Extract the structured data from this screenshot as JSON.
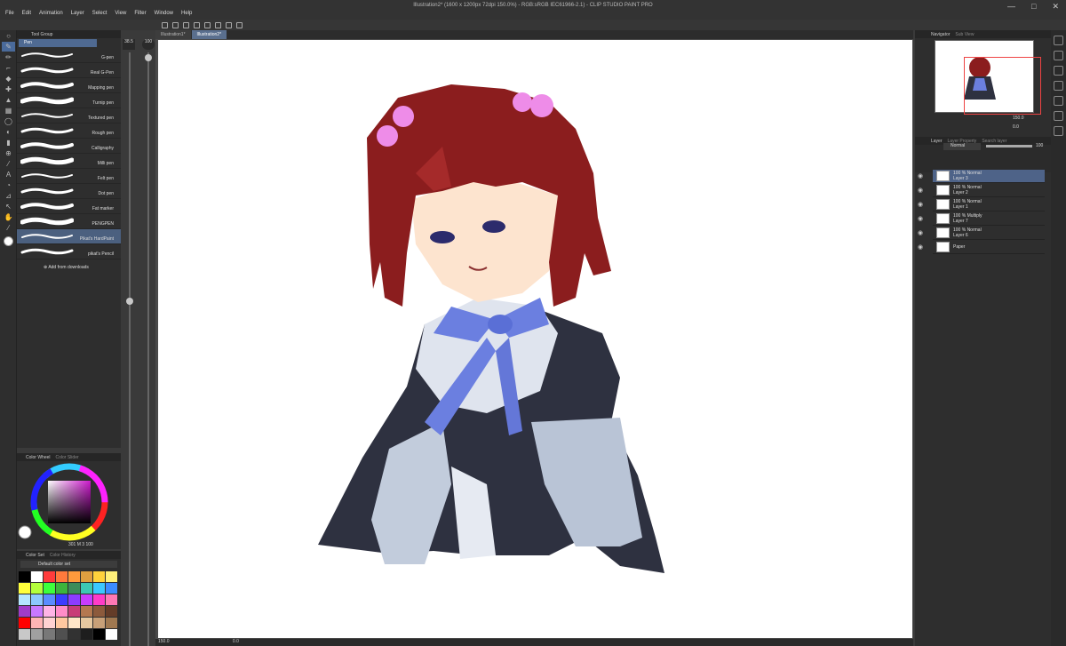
{
  "app": {
    "title": "Illustration2* (1600 x 1200px 72dpi 150.0%) - RGB:sRGB IEC61966-2.1) - CLIP STUDIO PAINT PRO"
  },
  "menu": [
    "File",
    "Edit",
    "Animation",
    "Layer",
    "Select",
    "View",
    "Filter",
    "Window",
    "Help"
  ],
  "window_controls": {
    "minimize": "—",
    "maximize": "□",
    "close": "✕"
  },
  "tool_group": {
    "tab": "Tool Group",
    "sub": "Pen"
  },
  "brushes": [
    {
      "name": "G-pen"
    },
    {
      "name": "Real G-Pen"
    },
    {
      "name": "Mapping pen"
    },
    {
      "name": "Turnip pen"
    },
    {
      "name": "Textured pen"
    },
    {
      "name": "Rough pen"
    },
    {
      "name": "Calligraphy"
    },
    {
      "name": "Milli pen"
    },
    {
      "name": "Felt pen"
    },
    {
      "name": "Dot pen"
    },
    {
      "name": "Fat marker"
    },
    {
      "name": "PENGPEN"
    },
    {
      "name": "Pikat's HardPaint"
    },
    {
      "name": "pikat's Pencil"
    }
  ],
  "add_from_downloads": "Add from downloads",
  "brush_size": {
    "value": "38.5",
    "opacity": "100"
  },
  "doc_tabs": [
    "Illustration1*",
    "Illustration2*"
  ],
  "color_panel": {
    "tab1": "Color Wheel",
    "tab2": "Color Slider",
    "readout": "301 M 3 100"
  },
  "color_set": {
    "tab1": "Color Set",
    "tab2": "Color History",
    "name": "Default color set"
  },
  "swatches": [
    "#000000",
    "#ffffff",
    "#ff3c3c",
    "#ff7a3c",
    "#ff9a3c",
    "#e0a040",
    "#ffd23c",
    "#fff07a",
    "#ffff3c",
    "#b4ff3c",
    "#3cff3c",
    "#3cb43c",
    "#3c8c5a",
    "#3cc8b4",
    "#3cc8ff",
    "#3c8cff",
    "#b4e6ff",
    "#8cc8ff",
    "#5a8cff",
    "#3c3cff",
    "#8c3cff",
    "#c83cff",
    "#ff3cc8",
    "#ff78b4",
    "#a03cc8",
    "#c878ff",
    "#ffb4e6",
    "#ff8cc8",
    "#c83c78",
    "#b47850",
    "#8c5a3c",
    "#643c28",
    "#ff0000",
    "#ffb4b4",
    "#ffd2d2",
    "#ffc8a0",
    "#ffe6c8",
    "#e6c8a0",
    "#c8a078",
    "#a07850",
    "#c8c8c8",
    "#a0a0a0",
    "#787878",
    "#505050",
    "#323232",
    "#1e1e1e",
    "#000000",
    "#ffffff"
  ],
  "navigator": {
    "tab1": "Navigator",
    "tab2": "Sub View",
    "zoom": "150.0",
    "angle": "0.0"
  },
  "layer_panel": {
    "tab1": "Layer",
    "tab2": "Layer Property",
    "tab3": "Search layer",
    "blend": "Normal",
    "opacity": "100"
  },
  "layers": [
    {
      "mode": "100 % Normal",
      "name": "Layer 3"
    },
    {
      "mode": "100 % Normal",
      "name": "Layer 2"
    },
    {
      "mode": "100 % Normal",
      "name": "Layer 1"
    },
    {
      "mode": "100 % Multiply",
      "name": "Layer 7"
    },
    {
      "mode": "100 % Normal",
      "name": "Layer 6"
    },
    {
      "mode": "",
      "name": "Paper"
    }
  ],
  "status": {
    "zoom": "150.0",
    "angle": "0.0"
  }
}
